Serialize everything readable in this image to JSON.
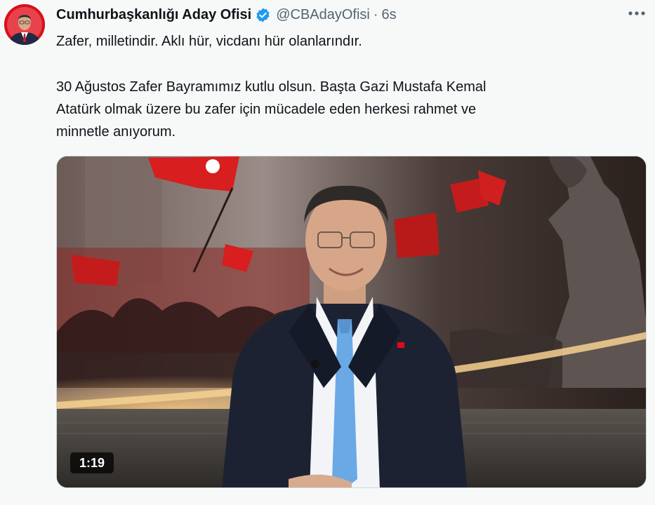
{
  "author": {
    "display_name": "Cumhurbaşkanlığı Aday Ofisi",
    "handle": "@CBAdayOfisi",
    "separator": "·",
    "time": "6s",
    "avatar_icon": "profile-photo",
    "verified_icon": "verified-badge-icon"
  },
  "tweet": {
    "paragraph1": "Zafer, milletindir. Aklı hür, vicdanı hür olanlarındır.",
    "paragraph2_line1": "30 Ağustos Zafer Bayramımız kutlu olsun. Başta Gazi Mustafa Kemal",
    "paragraph2_line2": "Atatürk olmak üzere bu zafer için mücadele eden herkesi rahmet ve",
    "paragraph2_line3": "minnetle anıyorum."
  },
  "media": {
    "type": "video",
    "duration": "1:19"
  },
  "colors": {
    "verified": "#1d9bf0",
    "text": "#0f1419",
    "secondary": "#536471",
    "flag_red": "#e30a17"
  }
}
